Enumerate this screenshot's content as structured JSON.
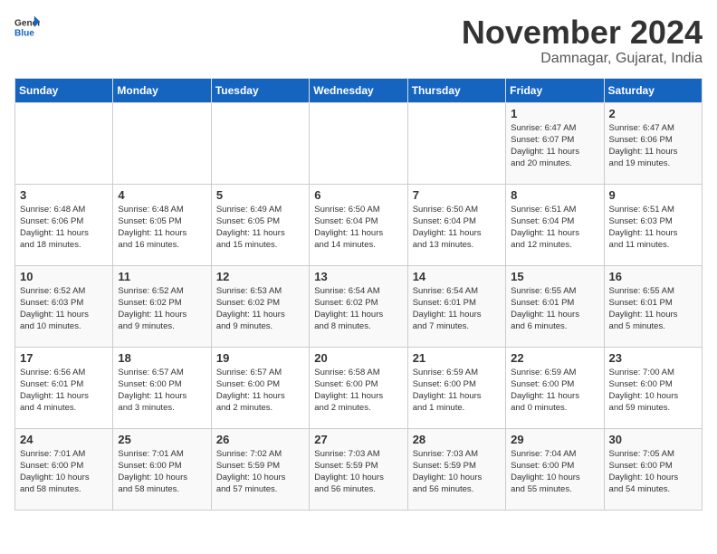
{
  "header": {
    "logo_general": "General",
    "logo_blue": "Blue",
    "month_title": "November 2024",
    "location": "Damnagar, Gujarat, India"
  },
  "days_of_week": [
    "Sunday",
    "Monday",
    "Tuesday",
    "Wednesday",
    "Thursday",
    "Friday",
    "Saturday"
  ],
  "weeks": [
    [
      {
        "day": "",
        "info": ""
      },
      {
        "day": "",
        "info": ""
      },
      {
        "day": "",
        "info": ""
      },
      {
        "day": "",
        "info": ""
      },
      {
        "day": "",
        "info": ""
      },
      {
        "day": "1",
        "info": "Sunrise: 6:47 AM\nSunset: 6:07 PM\nDaylight: 11 hours\nand 20 minutes."
      },
      {
        "day": "2",
        "info": "Sunrise: 6:47 AM\nSunset: 6:06 PM\nDaylight: 11 hours\nand 19 minutes."
      }
    ],
    [
      {
        "day": "3",
        "info": "Sunrise: 6:48 AM\nSunset: 6:06 PM\nDaylight: 11 hours\nand 18 minutes."
      },
      {
        "day": "4",
        "info": "Sunrise: 6:48 AM\nSunset: 6:05 PM\nDaylight: 11 hours\nand 16 minutes."
      },
      {
        "day": "5",
        "info": "Sunrise: 6:49 AM\nSunset: 6:05 PM\nDaylight: 11 hours\nand 15 minutes."
      },
      {
        "day": "6",
        "info": "Sunrise: 6:50 AM\nSunset: 6:04 PM\nDaylight: 11 hours\nand 14 minutes."
      },
      {
        "day": "7",
        "info": "Sunrise: 6:50 AM\nSunset: 6:04 PM\nDaylight: 11 hours\nand 13 minutes."
      },
      {
        "day": "8",
        "info": "Sunrise: 6:51 AM\nSunset: 6:04 PM\nDaylight: 11 hours\nand 12 minutes."
      },
      {
        "day": "9",
        "info": "Sunrise: 6:51 AM\nSunset: 6:03 PM\nDaylight: 11 hours\nand 11 minutes."
      }
    ],
    [
      {
        "day": "10",
        "info": "Sunrise: 6:52 AM\nSunset: 6:03 PM\nDaylight: 11 hours\nand 10 minutes."
      },
      {
        "day": "11",
        "info": "Sunrise: 6:52 AM\nSunset: 6:02 PM\nDaylight: 11 hours\nand 9 minutes."
      },
      {
        "day": "12",
        "info": "Sunrise: 6:53 AM\nSunset: 6:02 PM\nDaylight: 11 hours\nand 9 minutes."
      },
      {
        "day": "13",
        "info": "Sunrise: 6:54 AM\nSunset: 6:02 PM\nDaylight: 11 hours\nand 8 minutes."
      },
      {
        "day": "14",
        "info": "Sunrise: 6:54 AM\nSunset: 6:01 PM\nDaylight: 11 hours\nand 7 minutes."
      },
      {
        "day": "15",
        "info": "Sunrise: 6:55 AM\nSunset: 6:01 PM\nDaylight: 11 hours\nand 6 minutes."
      },
      {
        "day": "16",
        "info": "Sunrise: 6:55 AM\nSunset: 6:01 PM\nDaylight: 11 hours\nand 5 minutes."
      }
    ],
    [
      {
        "day": "17",
        "info": "Sunrise: 6:56 AM\nSunset: 6:01 PM\nDaylight: 11 hours\nand 4 minutes."
      },
      {
        "day": "18",
        "info": "Sunrise: 6:57 AM\nSunset: 6:00 PM\nDaylight: 11 hours\nand 3 minutes."
      },
      {
        "day": "19",
        "info": "Sunrise: 6:57 AM\nSunset: 6:00 PM\nDaylight: 11 hours\nand 2 minutes."
      },
      {
        "day": "20",
        "info": "Sunrise: 6:58 AM\nSunset: 6:00 PM\nDaylight: 11 hours\nand 2 minutes."
      },
      {
        "day": "21",
        "info": "Sunrise: 6:59 AM\nSunset: 6:00 PM\nDaylight: 11 hours\nand 1 minute."
      },
      {
        "day": "22",
        "info": "Sunrise: 6:59 AM\nSunset: 6:00 PM\nDaylight: 11 hours\nand 0 minutes."
      },
      {
        "day": "23",
        "info": "Sunrise: 7:00 AM\nSunset: 6:00 PM\nDaylight: 10 hours\nand 59 minutes."
      }
    ],
    [
      {
        "day": "24",
        "info": "Sunrise: 7:01 AM\nSunset: 6:00 PM\nDaylight: 10 hours\nand 58 minutes."
      },
      {
        "day": "25",
        "info": "Sunrise: 7:01 AM\nSunset: 6:00 PM\nDaylight: 10 hours\nand 58 minutes."
      },
      {
        "day": "26",
        "info": "Sunrise: 7:02 AM\nSunset: 5:59 PM\nDaylight: 10 hours\nand 57 minutes."
      },
      {
        "day": "27",
        "info": "Sunrise: 7:03 AM\nSunset: 5:59 PM\nDaylight: 10 hours\nand 56 minutes."
      },
      {
        "day": "28",
        "info": "Sunrise: 7:03 AM\nSunset: 5:59 PM\nDaylight: 10 hours\nand 56 minutes."
      },
      {
        "day": "29",
        "info": "Sunrise: 7:04 AM\nSunset: 6:00 PM\nDaylight: 10 hours\nand 55 minutes."
      },
      {
        "day": "30",
        "info": "Sunrise: 7:05 AM\nSunset: 6:00 PM\nDaylight: 10 hours\nand 54 minutes."
      }
    ]
  ]
}
